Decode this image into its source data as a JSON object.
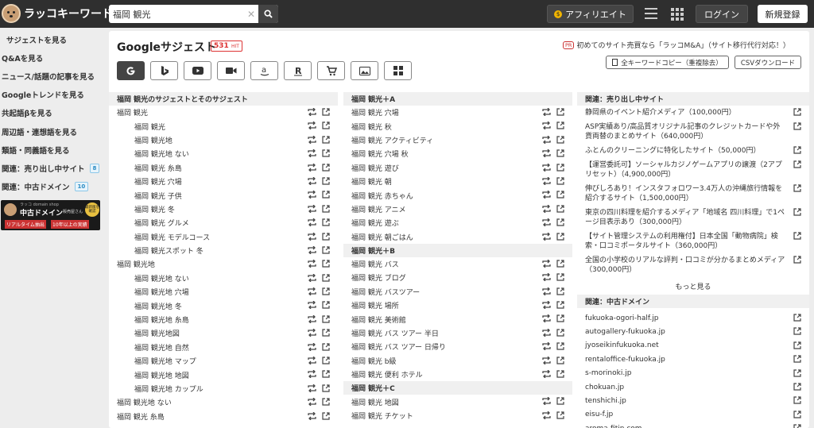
{
  "header": {
    "logo_text": "ラッコキーワード",
    "search": {
      "value": "福岡 観光"
    },
    "affiliate_label": "アフィリエイト",
    "login_label": "ログイン",
    "signup_label": "新規登録"
  },
  "sidebar": {
    "items": [
      {
        "label": "サジェストを見る",
        "active": true
      },
      {
        "label": "Q&Aを見る"
      },
      {
        "label": "ニュース/話題の記事を見る"
      },
      {
        "label": "Googleトレンドを見る"
      },
      {
        "label": "共起語βを見る"
      },
      {
        "label": "周辺語・連想語を見る"
      },
      {
        "label": "類語・同義語を見る"
      },
      {
        "label": "関連：売り出し中サイト",
        "badge": "8"
      },
      {
        "label": "関連：中古ドメイン",
        "badge": "10"
      }
    ],
    "banner": {
      "small_text": "ラッコ domain shop",
      "title": "中古ドメイン",
      "sub": "販売屋さん",
      "tag1": "リアルタイム抽出",
      "tag2": "10年以上の実績",
      "circle": "最新版を確認"
    }
  },
  "main": {
    "title": "Googleサジェスト",
    "hit_count": "531",
    "hit_unit": "HIT",
    "pr_badge": "PR",
    "pr_text": "初めてのサイト売買なら「ラッコM&A」（サイト移行代行対応！）",
    "copy_all_label": "全キーワードコピー（重複除去）",
    "csv_label": "CSVダウンロード",
    "tabs": [
      "google",
      "bing",
      "youtube",
      "video",
      "amazon",
      "rakuten",
      "shopping",
      "image",
      "apps"
    ]
  },
  "col1": {
    "header": "福岡 観光のサジェストとそのサジェスト",
    "rows": [
      {
        "text": "福岡 観光",
        "sub": false
      },
      {
        "text": "福岡 観光",
        "sub": true
      },
      {
        "text": "福岡 観光地",
        "sub": true
      },
      {
        "text": "福岡 観光地 ない",
        "sub": true
      },
      {
        "text": "福岡 観光 糸島",
        "sub": true
      },
      {
        "text": "福岡 観光 穴場",
        "sub": true
      },
      {
        "text": "福岡 観光 子供",
        "sub": true
      },
      {
        "text": "福岡 観光 冬",
        "sub": true
      },
      {
        "text": "福岡 観光 グルメ",
        "sub": true
      },
      {
        "text": "福岡 観光 モデルコース",
        "sub": true
      },
      {
        "text": "福岡 観光スポット 冬",
        "sub": true
      },
      {
        "text": "福岡 観光地",
        "sub": false
      },
      {
        "text": "福岡 観光地 ない",
        "sub": true
      },
      {
        "text": "福岡 観光地 穴場",
        "sub": true
      },
      {
        "text": "福岡 観光地 冬",
        "sub": true
      },
      {
        "text": "福岡 観光地 糸島",
        "sub": true
      },
      {
        "text": "福岡 観光地図",
        "sub": true
      },
      {
        "text": "福岡 観光地 自然",
        "sub": true
      },
      {
        "text": "福岡 観光地 マップ",
        "sub": true
      },
      {
        "text": "福岡 観光地 地図",
        "sub": true
      },
      {
        "text": "福岡 観光地 カップル",
        "sub": true
      },
      {
        "text": "福岡 観光地 ない",
        "sub": false
      },
      {
        "text": "福岡 観光 糸島",
        "sub": false
      }
    ]
  },
  "col2": {
    "groups": [
      {
        "header": "福岡 観光＋A",
        "rows": [
          "福岡 観光 穴場",
          "福岡 観光 秋",
          "福岡 観光 アクティビティ",
          "福岡 観光 穴場 秋",
          "福岡 観光 遊び",
          "福岡 観光 朝",
          "福岡 観光 赤ちゃん",
          "福岡 観光 アニメ",
          "福岡 観光 遊ぶ",
          "福岡 観光 朝ごはん"
        ]
      },
      {
        "header": "福岡 観光＋B",
        "rows": [
          "福岡 観光 バス",
          "福岡 観光 ブログ",
          "福岡 観光 バスツアー",
          "福岡 観光 場所",
          "福岡 観光 美術館",
          "福岡 観光 バス ツアー 半日",
          "福岡 観光 バス ツアー 日帰り",
          "福岡 観光 b級",
          "福岡 観光 便利 ホテル"
        ]
      },
      {
        "header": "福岡 観光＋C",
        "rows": [
          "福岡 観光 地図",
          "福岡 観光 チケット"
        ]
      }
    ]
  },
  "col3": {
    "sites_header": "関連：売り出し中サイト",
    "sites": [
      "静岡県のイベント紹介メディア（100,000円）",
      "ASP実績あり/高品質オリジナル記事のクレジットカードや外貨両替のまとめサイト（640,000円）",
      "ふとんのクリーニングに特化したサイト（50,000円）",
      "【運営委託可】ソーシャルカジノゲームアプリの譲渡（2アプリセット）（4,900,000円）",
      "伸びしろあり！インスタフォロワー3.4万人の沖縄旅行情報を紹介するサイト（1,500,000円）",
      "東京の四川料理を紹介するメディア「地域名 四川料理」で1ページ目表示あり（300,000円）",
      "【サイト管理システムの利用権付】日本全国「動物病院」検索・口コミポータルサイト（360,000円）",
      "全国の小学校のリアルな評判・口コミが分かるまとめメディア（300,000円）"
    ],
    "more_label": "もっと見る",
    "domains_header": "関連：中古ドメイン",
    "domains": [
      "fukuoka-ogori-half.jp",
      "autogallery-fukuoka.jp",
      "jyoseikinfukuoka.net",
      "rentaloffice-fukuoka.jp",
      "s-morinoki.jp",
      "chokuan.jp",
      "tenshichi.jp",
      "eisu-f.jp",
      "aroma-fitin.com"
    ]
  }
}
